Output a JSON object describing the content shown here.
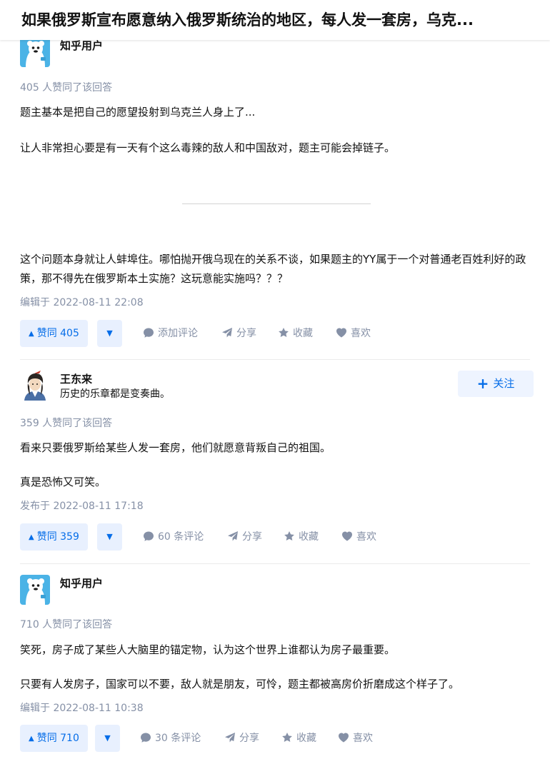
{
  "question": {
    "title": "如果俄罗斯宣布愿意纳入俄罗斯统治的地区，每人发一套房，乌克..."
  },
  "answers": [
    {
      "author": {
        "name": "知乎用户",
        "headline": "",
        "avatar": "zhihu-anonymous-avatar"
      },
      "voters": "405 人赞同了该回答",
      "paragraphs": [
        "题主基本是把自己的愿望投射到乌克兰人身上了...",
        "让人非常担心要是有一天有个这么毒辣的敌人和中国敌对，题主可能会掉链子。",
        "这个问题本身就让人蚌埠住。哪怕抛开俄乌现在的关系不谈，如果题主的YY属于一个对普通老百姓利好的政策，那不得先在俄罗斯本土实施？这玩意能实施吗？？？"
      ],
      "time": "编辑于 2022-08-11 22:08",
      "actions": {
        "vote": "赞同 405",
        "comment": "添加评论",
        "share": "分享",
        "collect": "收藏",
        "like": "喜欢"
      }
    },
    {
      "author": {
        "name": "王东来",
        "headline": "历史的乐章都是变奏曲。",
        "avatar": "anime-character-avatar"
      },
      "follow": "关注",
      "voters": "359 人赞同了该回答",
      "paragraphs": [
        "看来只要俄罗斯给某些人发一套房，他们就愿意背叛自己的祖国。",
        "真是恐怖又可笑。"
      ],
      "time": "发布于 2022-08-11 17:18",
      "actions": {
        "vote": "赞同 359",
        "comment": "60 条评论",
        "share": "分享",
        "collect": "收藏",
        "like": "喜欢"
      }
    },
    {
      "author": {
        "name": "知乎用户",
        "headline": "",
        "avatar": "zhihu-anonymous-avatar"
      },
      "voters": "710 人赞同了该回答",
      "paragraphs": [
        "笑死，房子成了某些人大脑里的锚定物，认为这个世界上谁都认为房子最重要。",
        "只要有人发房子，国家可以不要，敌人就是朋友，可怜，题主都被高房价折磨成这个样子了。"
      ],
      "time": "编辑于 2022-08-11 10:38",
      "actions": {
        "vote": "赞同 710",
        "comment": "30 条评论",
        "share": "分享",
        "collect": "收藏",
        "like": "喜欢"
      }
    }
  ],
  "icons": {
    "vote_up": "up-triangle-icon",
    "vote_down": "down-triangle-icon",
    "comment": "comment-bubble-icon",
    "share": "paper-plane-icon",
    "collect": "star-icon",
    "like": "heart-icon",
    "follow": "plus-icon"
  },
  "colors": {
    "brand": "#056de8",
    "vote_bg": "#e8f0fe",
    "meta_gray": "#8590a6",
    "text": "#121212"
  }
}
